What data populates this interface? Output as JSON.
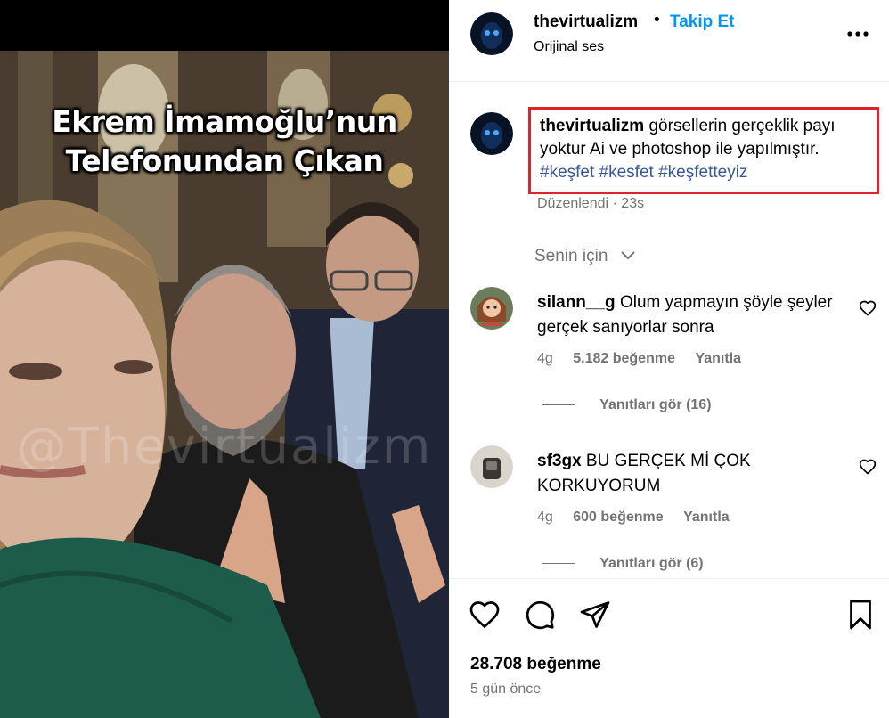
{
  "media": {
    "overlay_line1": "Ekrem İmamoğlu’nun",
    "overlay_line2": "Telefonundan Çıkan",
    "watermark": "@Thevirtualizm"
  },
  "header": {
    "username": "thevirtualizm",
    "separator": "•",
    "follow_label": "Takip Et",
    "audio_label": "Orijinal ses"
  },
  "caption": {
    "username": "thevirtualizm",
    "text": "görsellerin gerçeklik payı yoktur Ai ve photoshop ile yapılmıştır.",
    "hashtags": [
      "#keşfet",
      "#kesfet",
      "#keşfetteyiz"
    ],
    "edited_label": "Düzenlendi",
    "separator": "·",
    "time": "23s"
  },
  "filter": {
    "label": "Senin için"
  },
  "comments": [
    {
      "username": "silann__g",
      "text": "Olum yapmayın şöyle şeyler gerçek sanıyorlar sonra",
      "time": "4g",
      "likes": "5.182 beğenme",
      "reply_label": "Yanıtla",
      "view_replies": "Yanıtları gör (16)"
    },
    {
      "username": "sf3gx",
      "text": "BU GERÇEK Mİ ÇOK KORKUYORUM",
      "time": "4g",
      "likes": "600 beğenme",
      "reply_label": "Yanıtla",
      "view_replies": "Yanıtları gör (6)"
    }
  ],
  "footer": {
    "likes": "28.708 beğenme",
    "date": "5 gün önce"
  },
  "colors": {
    "accent": "#0095f6",
    "hashtag": "#385898",
    "highlight_box": "#e0232b",
    "muted": "#737373"
  },
  "icons": [
    "more-options-icon",
    "heart-icon",
    "comment-icon",
    "share-icon",
    "bookmark-icon",
    "chevron-down-icon"
  ]
}
